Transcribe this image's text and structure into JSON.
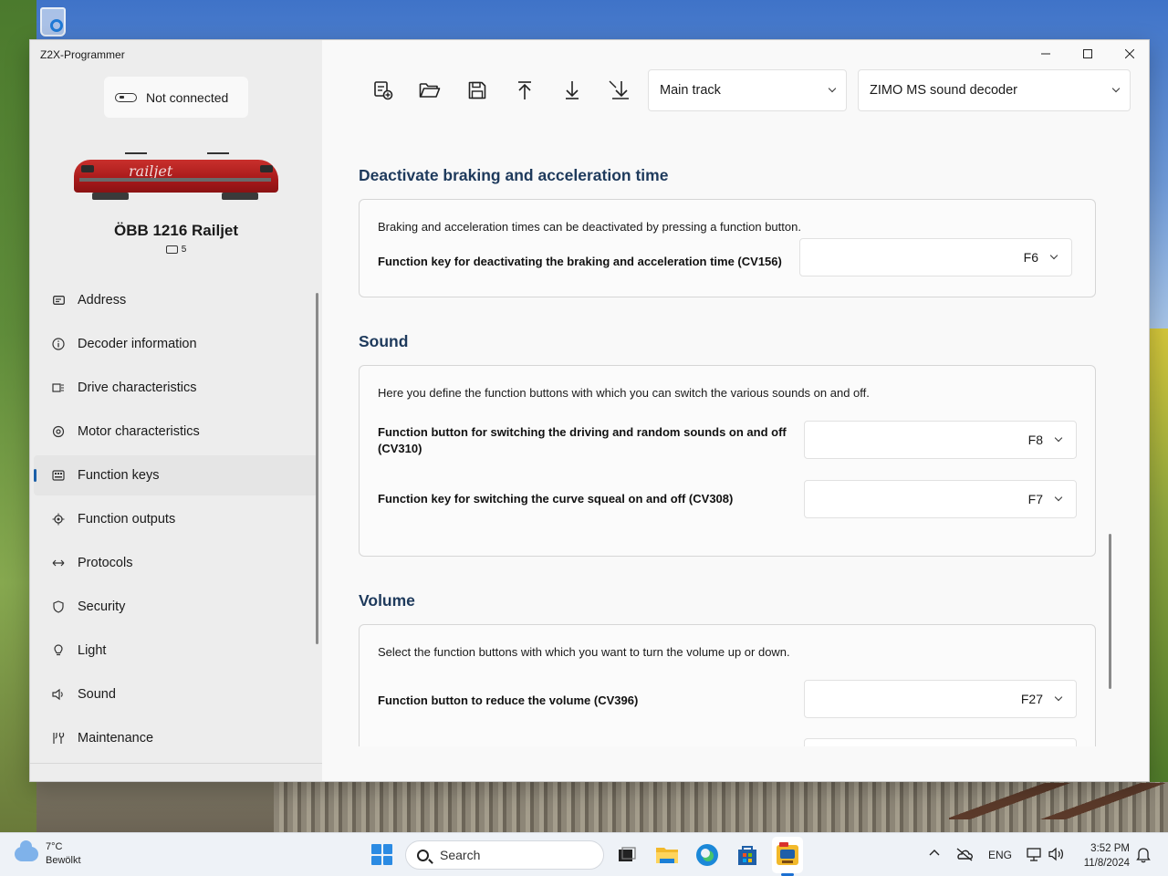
{
  "window": {
    "title": "Z2X-Programmer",
    "controls": [
      "minimize",
      "maximize",
      "close"
    ]
  },
  "sidebar": {
    "connection_status": "Not connected",
    "loco": {
      "livery_text": "railjet",
      "name": "ÖBB 1216 Railjet",
      "address": "5"
    },
    "items": [
      {
        "label": "Address",
        "icon": "address-card-icon"
      },
      {
        "label": "Decoder information",
        "icon": "info-icon"
      },
      {
        "label": "Drive characteristics",
        "icon": "drive-icon"
      },
      {
        "label": "Motor characteristics",
        "icon": "motor-icon"
      },
      {
        "label": "Function keys",
        "icon": "function-keys-icon",
        "active": true
      },
      {
        "label": "Function outputs",
        "icon": "function-outputs-icon"
      },
      {
        "label": "Protocols",
        "icon": "protocols-icon"
      },
      {
        "label": "Security",
        "icon": "shield-icon"
      },
      {
        "label": "Light",
        "icon": "lightbulb-icon"
      },
      {
        "label": "Sound",
        "icon": "speaker-icon"
      },
      {
        "label": "Maintenance",
        "icon": "wrench-icon"
      }
    ]
  },
  "toolbar": {
    "buttons": [
      "new-project-icon",
      "open-folder-icon",
      "save-icon",
      "upload-icon",
      "download-icon",
      "download-changed-icon"
    ],
    "track_mode": "Main track",
    "decoder": "ZIMO MS sound decoder"
  },
  "sections": {
    "braking": {
      "title": "Deactivate braking and acceleration time",
      "description": "Braking and acceleration times can be deactivated by pressing a function button.",
      "label": "Function key for deactivating the braking and acceleration time (CV156)",
      "value": "F6"
    },
    "sound": {
      "title": "Sound",
      "description": "Here you define the function buttons with which you can switch the various sounds on and off.",
      "driving_label": "Function button for switching the driving and random sounds on and off (CV310)",
      "driving_value": "F8",
      "squeal_label": "Function key for switching the curve squeal on and off (CV308)",
      "squeal_value": "F7"
    },
    "volume": {
      "title": "Volume",
      "description": "Select the function buttons with which you want to turn the volume up or down.",
      "reduce_label": "Function button to reduce the volume (CV396)",
      "reduce_value": "F27"
    }
  },
  "taskbar": {
    "weather_temp": "7°C",
    "weather_desc": "Bewölkt",
    "search_placeholder": "Search",
    "language": "ENG",
    "time": "3:52 PM",
    "date": "11/8/2024"
  }
}
